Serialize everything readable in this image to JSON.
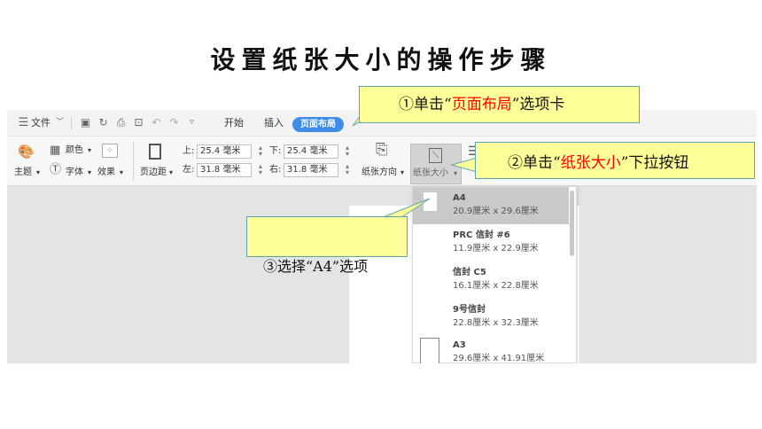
{
  "slide": {
    "title": "设置纸张大小的操作步骤"
  },
  "menu": {
    "file_label": "文件",
    "tabs": [
      "开始",
      "插入",
      "页面布局"
    ],
    "active_tab": "页面布局"
  },
  "ribbon": {
    "theme_label": "主题",
    "color_label": "颜色",
    "font_label": "字体",
    "effect_label": "效果",
    "margin_label": "页边距",
    "margins": {
      "top_label": "上:",
      "top_value": "25.4 毫米",
      "bottom_label": "下:",
      "bottom_value": "25.4 毫米",
      "left_label": "左:",
      "left_value": "31.8 毫米",
      "right_label": "右:",
      "right_value": "31.8 毫米"
    },
    "orientation_label": "纸张方向",
    "paper_size_label": "纸张大小"
  },
  "dropdown": {
    "items": [
      {
        "name": "A4",
        "size": "20.9厘米 x 29.6厘米",
        "selected": true
      },
      {
        "name": "PRC 信封 #6",
        "size": "11.9厘米 x 22.9厘米",
        "selected": false
      },
      {
        "name": "信封 C5",
        "size": "16.1厘米 x 22.8厘米",
        "selected": false
      },
      {
        "name": "9号信封",
        "size": "22.8厘米 x 32.3厘米",
        "selected": false
      },
      {
        "name": "A3",
        "size": "29.6厘米 x 41.91厘米",
        "selected": false
      }
    ]
  },
  "callouts": {
    "step1": {
      "prefix": "①单击“",
      "highlight": "页面布局",
      "suffix": "”选项卡"
    },
    "step2": {
      "prefix": "②单击“",
      "highlight": "纸张大小",
      "suffix": "”下拉按钮"
    },
    "step3": {
      "text": "③选择“A4”选项"
    }
  },
  "colors": {
    "accent": "#3f8de8",
    "callout_fill": "#ffff99",
    "callout_border": "#5aa5b0",
    "highlight": "#ff0000"
  },
  "icons": [
    "menu-icon",
    "save-icon",
    "undo-icon",
    "redo-icon",
    "print-icon",
    "preview-icon",
    "theme-icon",
    "color-icon",
    "font-icon",
    "effect-icon",
    "margin-icon",
    "orientation-icon",
    "paper-size-icon",
    "page-icon"
  ]
}
